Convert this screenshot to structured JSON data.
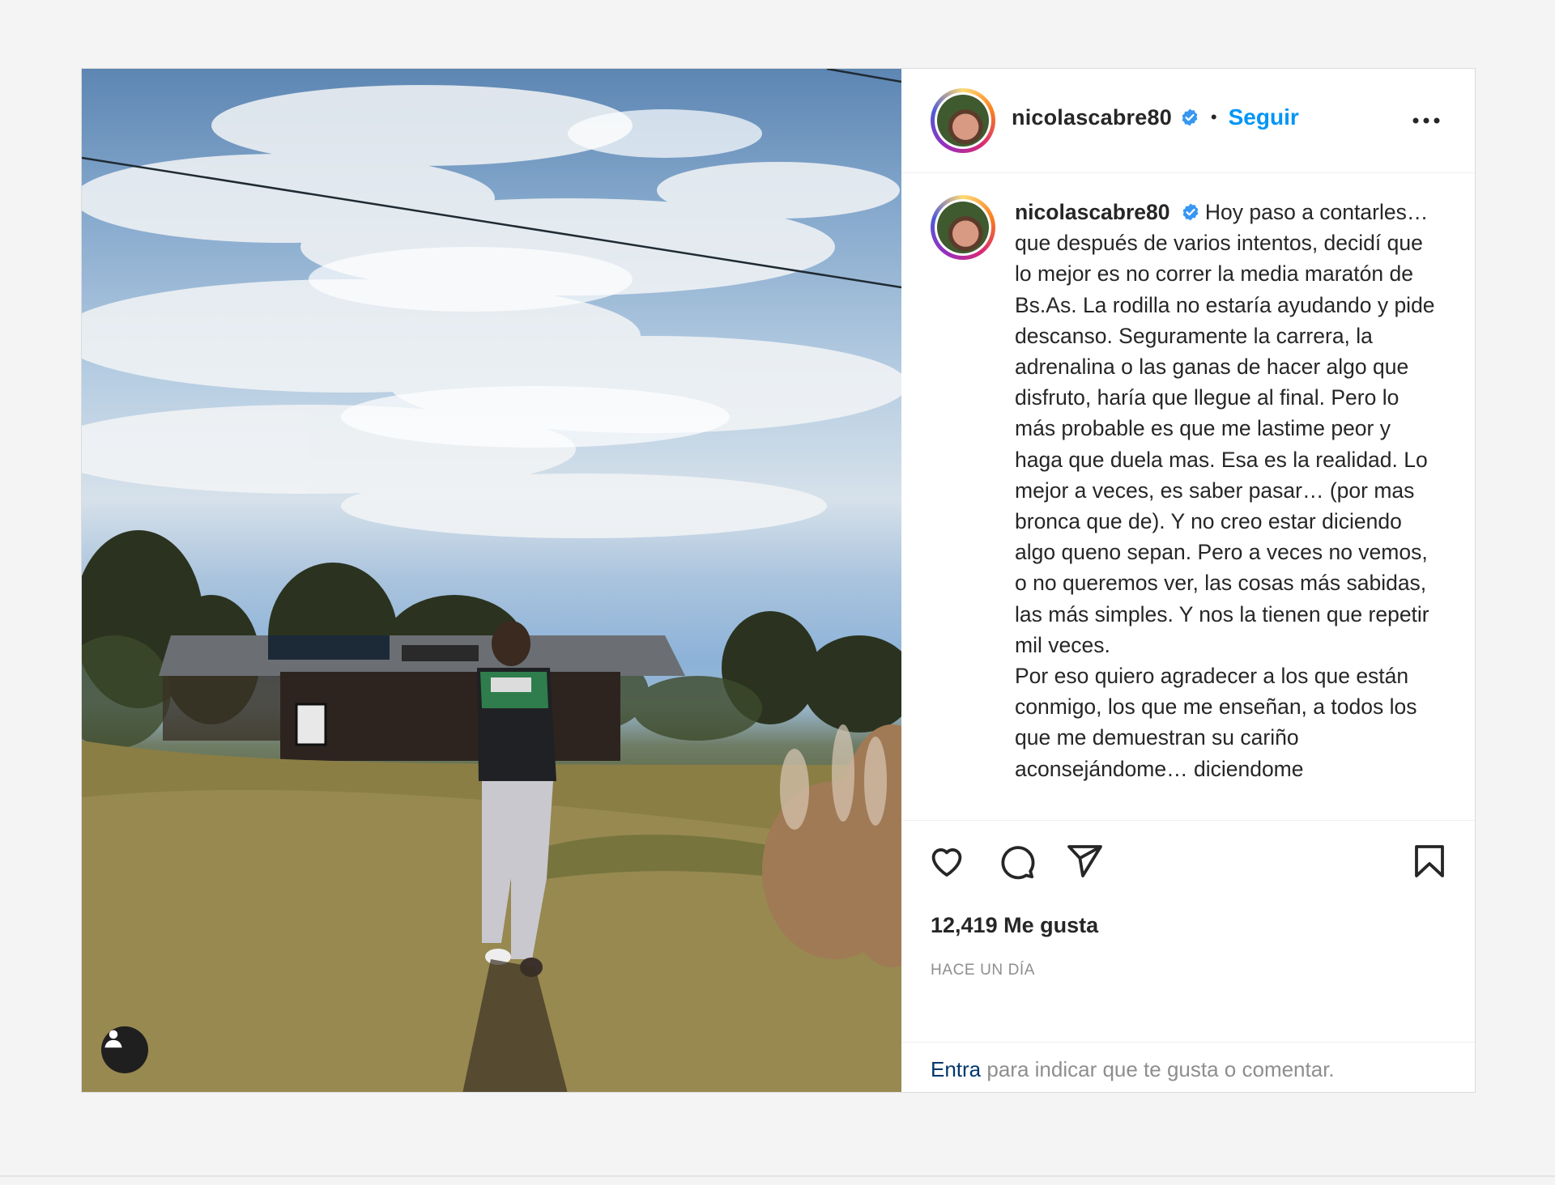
{
  "post": {
    "username": "nicolascabre80",
    "dot": "•",
    "follow_label": "Seguir",
    "more_icon": "more-horizontal-icon",
    "verified_icon": "verified-badge-icon",
    "caption_paragraphs": [
      "Hoy paso a contarles… que después de varios intentos, decidí que lo mejor es no correr la media maratón de Bs.As. La rodilla no estaría ayudando y pide descanso. Seguramente la carrera, la adrenalina o las ganas de hacer algo que disfruto, haría que llegue al final. Pero lo más probable es que me lastime peor y haga que duela mas. Esa es la realidad. Lo mejor a veces, es saber pasar… (por mas bronca que de). Y no creo estar diciendo algo queno sepan. Pero a veces no vemos, o no queremos ver, las cosas más sabidas, las más simples. Y nos la tienen que repetir mil veces.",
      "Por eso quiero agradecer a los que están conmigo, los que me enseñan, a todos los que me demuestran su cariño aconsejándome… diciendome"
    ],
    "likes": "12,419 Me gusta",
    "time": "HACE UN DÍA",
    "login_link": "Entra",
    "login_rest": " para indicar que te gusta o comentar.",
    "icons": {
      "like": "heart-icon",
      "comment": "comment-icon",
      "share": "send-icon",
      "save": "bookmark-icon",
      "tagged": "user-tag-icon"
    }
  }
}
